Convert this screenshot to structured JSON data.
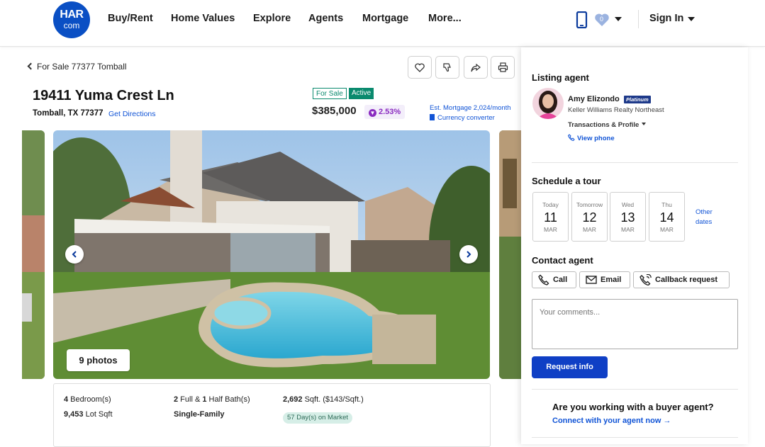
{
  "header": {
    "logo_top": "HAR",
    "logo_bottom": "com",
    "nav": [
      "Buy/Rent",
      "Home Values",
      "Explore",
      "Agents",
      "Mortgage",
      "More..."
    ],
    "favorites_count": "0",
    "sign_in": "Sign In"
  },
  "listing": {
    "back_label": "For Sale 77377 Tomball",
    "address": "19411 Yuma Crest Ln",
    "city": "Tomball, TX 77377",
    "directions": "Get Directions",
    "tag_for_sale": "For Sale",
    "tag_active": "Active",
    "price": "$385,000",
    "price_change": "2.53%",
    "mortgage": "Est. Mortgage 2,024/month",
    "currency": "Currency converter",
    "photos_label": "9 photos",
    "facts": {
      "beds_num": "4",
      "beds_label": " Bedroom(s)",
      "baths_full": "2",
      "baths_mid": " Full & ",
      "baths_half": "1",
      "baths_label": " Half Bath(s)",
      "sqft": "2,692",
      "sqft_label": " Sqft. ($143/Sqft.)",
      "lot": "9,453",
      "lot_label": " Lot Sqft",
      "type": "Single-Family",
      "dom": "57 Day(s) on Market"
    }
  },
  "panel": {
    "listing_agent_title": "Listing agent",
    "agent_name": "Amy Elizondo",
    "agent_tier": "Platinum",
    "brokerage": "Keller Williams Realty Northeast",
    "tx_profile": "Transactions & Profile",
    "view_phone": "View phone",
    "tour_title": "Schedule a tour",
    "dates": [
      {
        "dow": "Today",
        "day": "11",
        "mon": "MAR"
      },
      {
        "dow": "Tomorrow",
        "day": "12",
        "mon": "MAR"
      },
      {
        "dow": "Wed",
        "day": "13",
        "mon": "MAR"
      },
      {
        "dow": "Thu",
        "day": "14",
        "mon": "MAR"
      }
    ],
    "other_dates": "Other dates",
    "contact_title": "Contact agent",
    "call": "Call",
    "email": "Email",
    "callback": "Callback request",
    "comments_placeholder": "Your comments...",
    "request_info": "Request info",
    "buyer_question": "Are you working with a buyer agent?",
    "buyer_link": "Connect with your agent now →"
  },
  "colors": {
    "brand": "#0a4fc4",
    "link": "#1154d6",
    "active": "#0a8a6e",
    "primary_button": "#0f3fc5"
  }
}
